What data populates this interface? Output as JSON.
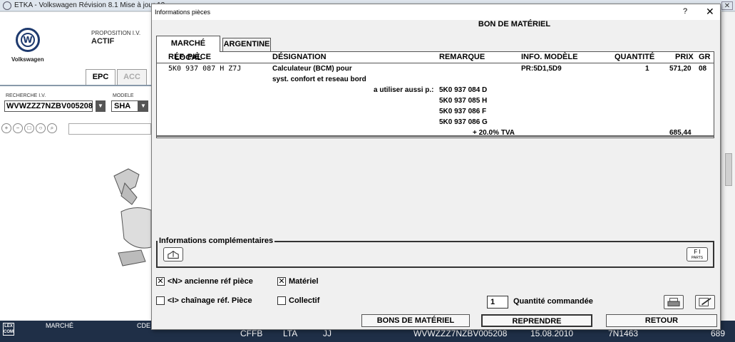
{
  "background": {
    "window_title": "ETKA - Volkswagen Révision 8.1 Mise à jour 13",
    "brand": "Volkswagen",
    "proposition_label": "PROPOSITION I.V.",
    "proposition_value": "ACTIF",
    "tabs": [
      "EPC",
      "ACC"
    ],
    "search_label": "RECHERCHE I.V.",
    "vin": "WVWZZZ7NZBV005208",
    "model_label": "MODELE",
    "model_value": "SHA",
    "bottom_bar": {
      "marche_label": "MARCHÉ",
      "cde_label": "CDE",
      "values": [
        "CFFB",
        "LTA",
        "JJ",
        "WVWZZZ7NZBV005208",
        "15.08.2010",
        "7N1463",
        "689"
      ]
    }
  },
  "dialog": {
    "title": "Informations pièces",
    "help": "?",
    "close": "✕",
    "heading": "BON DE MATÉRIEL",
    "tabs": [
      {
        "label": "MARCHÉ LOCAL",
        "active": true
      },
      {
        "label": "ARGENTINE",
        "active": false
      }
    ],
    "columns": {
      "ref": "RÉF. PIÈCE",
      "designation": "DÉSIGNATION",
      "remarque": "REMARQUE",
      "info_modele": "INFO. MODÈLE",
      "quantite": "QUANTITÉ",
      "prix": "PRIX",
      "gr": "GR"
    },
    "row": {
      "ref": "5K0 937 087 H  Z7J",
      "designation_1": "Calculateur (BCM) pour",
      "designation_2": "syst. confort et reseau bord",
      "info_modele": "PR:5D1,5D9",
      "quantite": "1",
      "prix": "571,20",
      "gr": "08",
      "also_label": "a utiliser aussi p.:",
      "alternatives": [
        "5K0 937 084 D",
        "5K0 937 085 H",
        "5K0 937 086 F",
        "5K0 937 086 G"
      ],
      "tva_label": "+ 20.0% TVA",
      "tva_total": "685,44"
    },
    "info_section_label": "Informations complémentaires",
    "parts_icon_text": "PARTS",
    "checkboxes": [
      {
        "label": "<N> ancienne réf pièce",
        "checked": true
      },
      {
        "label": "Matériel",
        "checked": true
      },
      {
        "label": "<I> chaînage réf. Pièce",
        "checked": false
      },
      {
        "label": "Collectif",
        "checked": false
      }
    ],
    "quantity_value": "1",
    "quantity_label": "Quantité commandée",
    "buttons": {
      "bons": "BONS DE MATÉRIEL",
      "reprendre": "REPRENDRE",
      "retour": "RETOUR"
    }
  }
}
